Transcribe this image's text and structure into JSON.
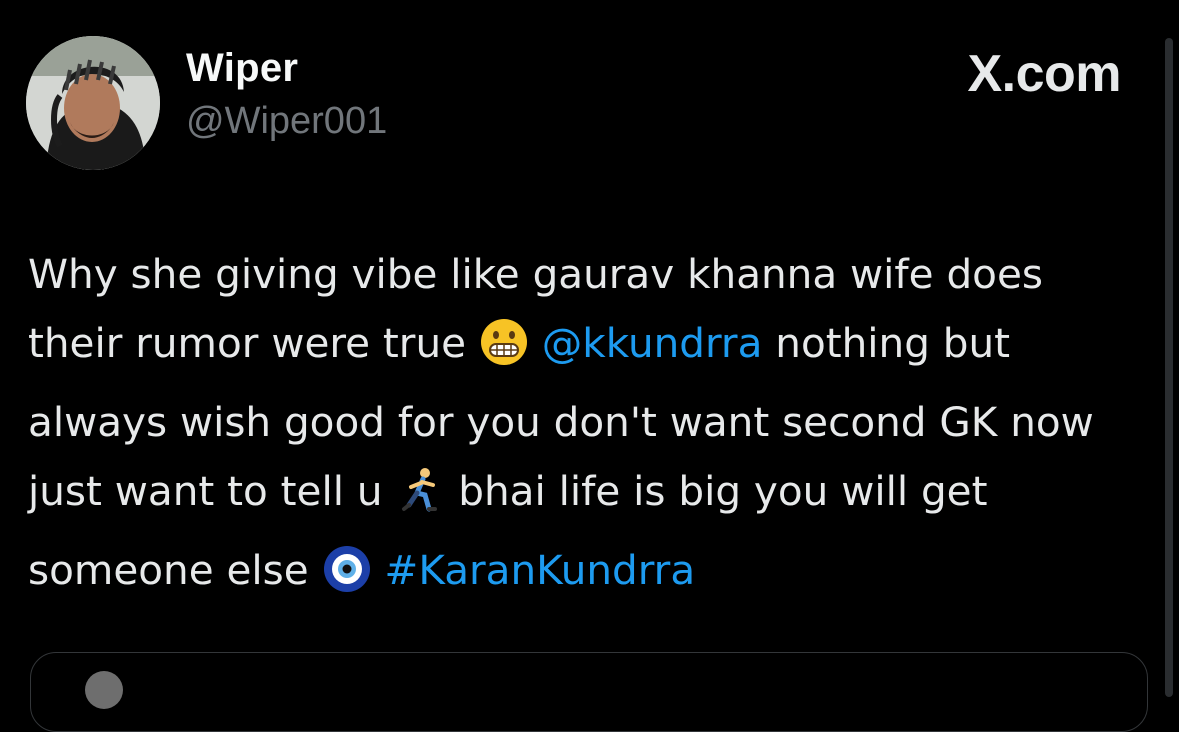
{
  "post": {
    "author": {
      "display_name": "Wiper",
      "handle": "@Wiper001",
      "avatar_icon": "profile-photo"
    },
    "brand": "X.com",
    "text": {
      "segment1": "Why she giving vibe like gaurav khanna wife does their rumor were true ",
      "emoji1": "grimacing-face",
      "mention": "@kkundrra",
      "segment2": " nothing but always wish good for you don't want second GK now just want to tell u ",
      "emoji2": "person-running",
      "segment3": " bhai life is big you will get someone else ",
      "emoji3": "nazar-amulet",
      "hashtag": "#KaranKundrra"
    },
    "colors": {
      "background": "#000000",
      "text": "#e7e9ea",
      "secondary": "#71767b",
      "link": "#1d9bf0"
    }
  }
}
